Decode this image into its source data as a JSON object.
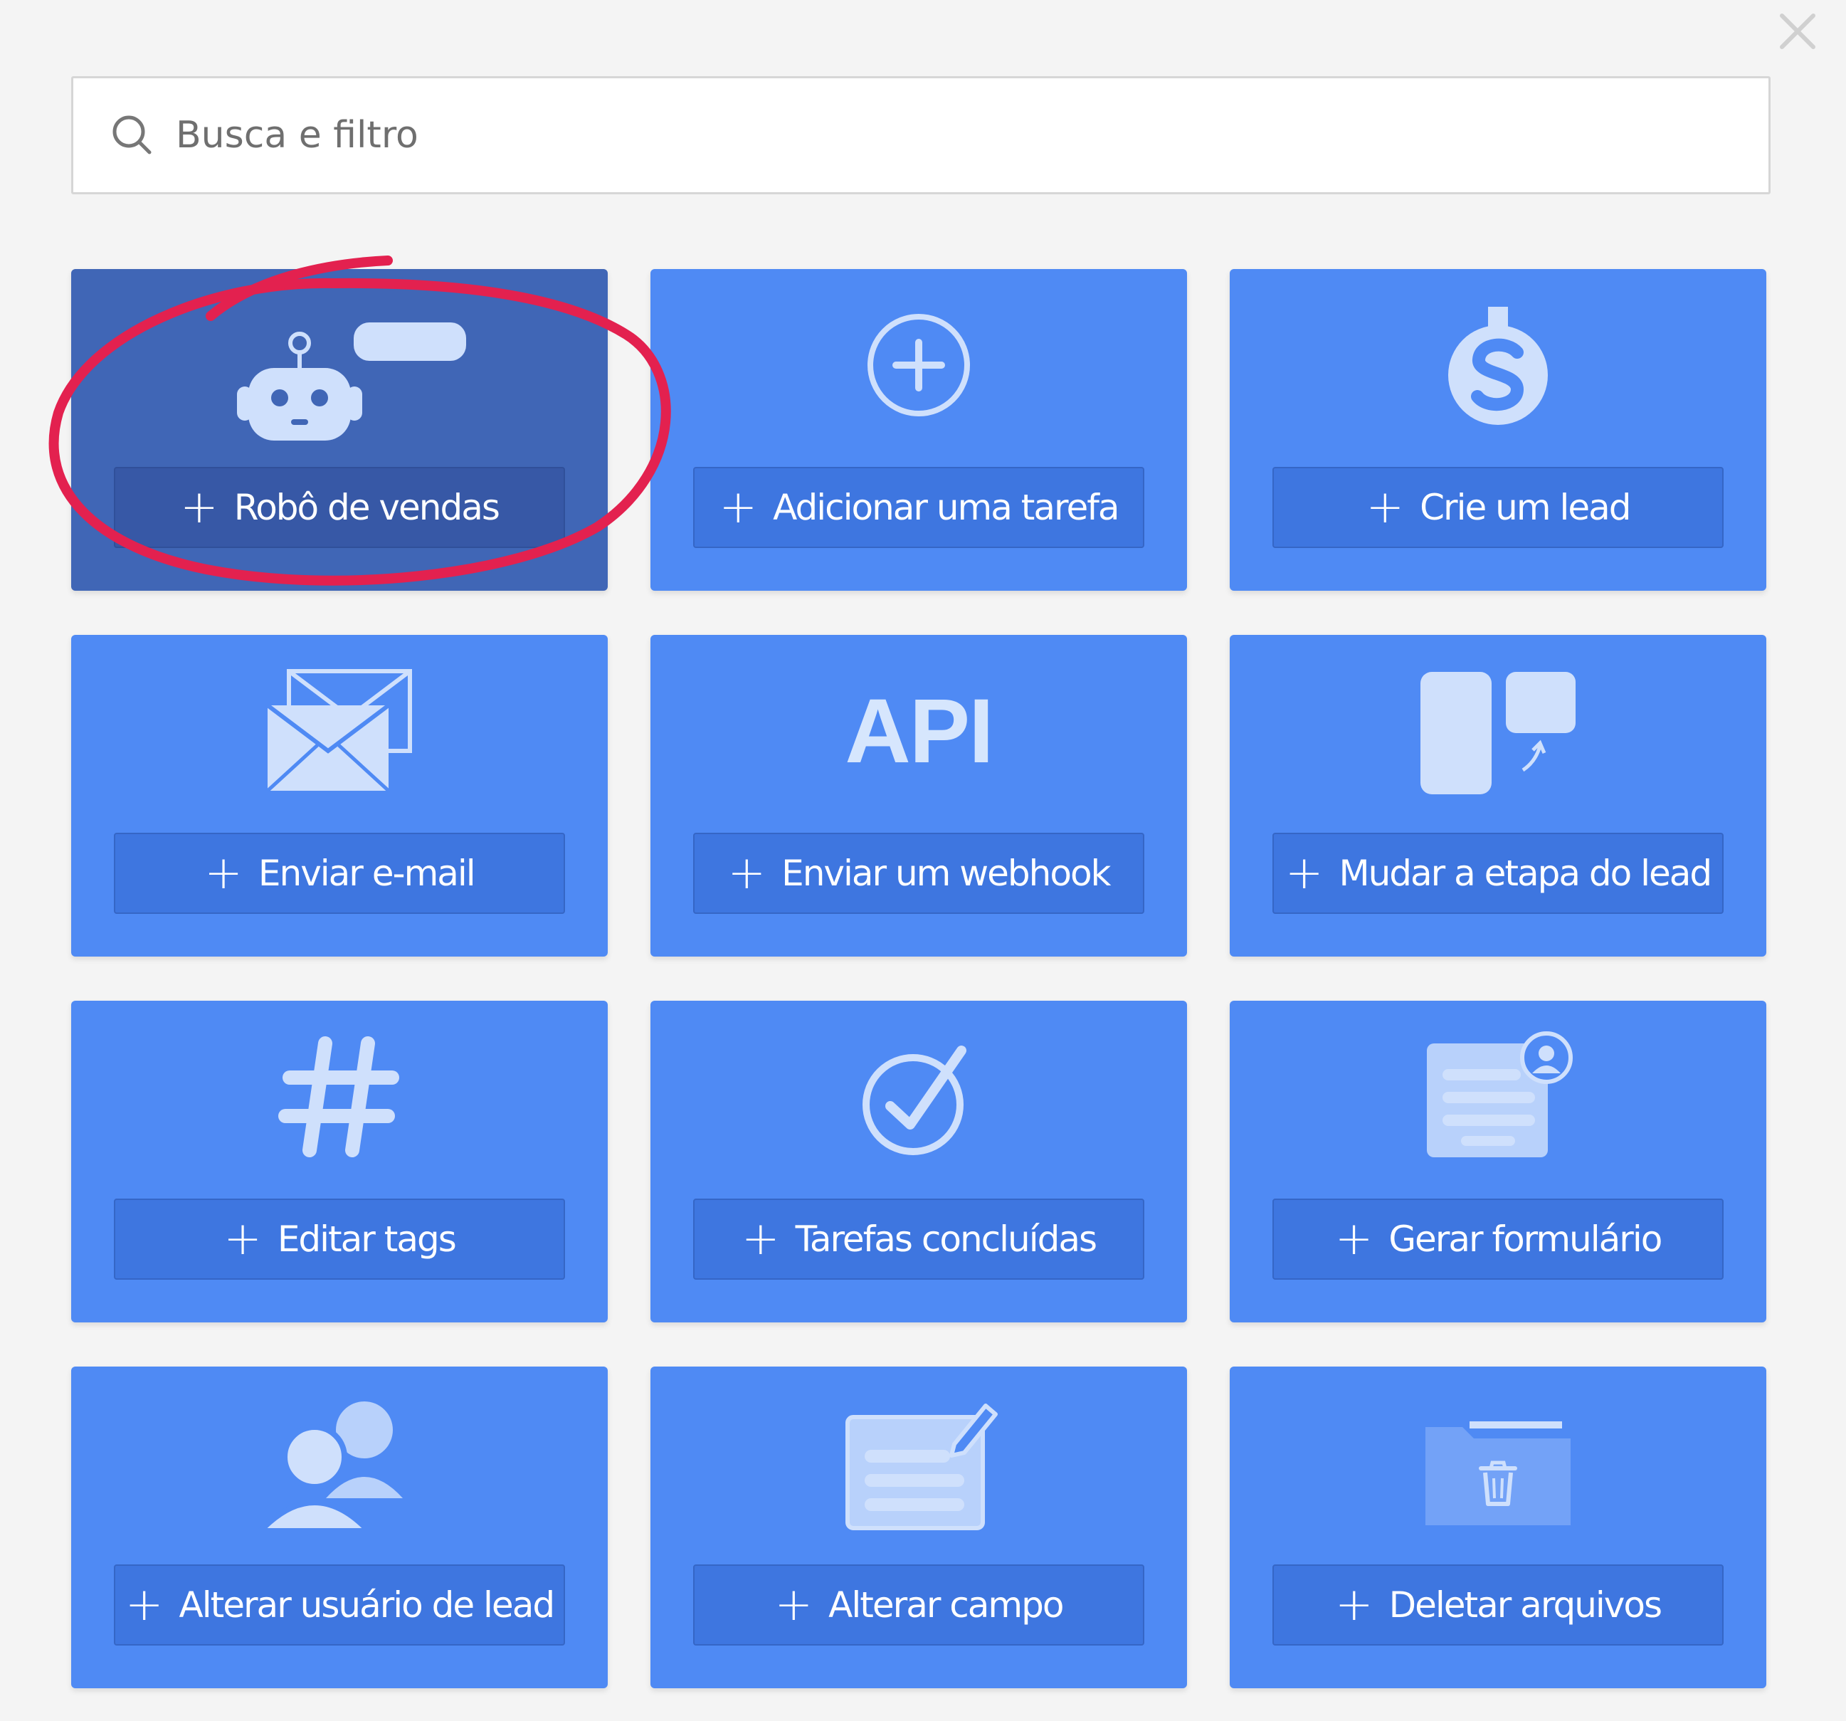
{
  "search": {
    "placeholder": "Busca e filtro",
    "icon": "search-icon"
  },
  "close_icon": "close-icon",
  "tiles": [
    {
      "label": "Robô de vendas",
      "icon": "robot-icon",
      "selected": true
    },
    {
      "label": "Adicionar uma tarefa",
      "icon": "plus-circle-icon"
    },
    {
      "label": "Crie um lead",
      "icon": "dollar-icon"
    },
    {
      "label": "Enviar e-mail",
      "icon": "envelope-icon"
    },
    {
      "label": "Enviar um webhook",
      "icon": "api-icon",
      "icon_text": "API"
    },
    {
      "label": "Mudar a etapa do lead",
      "icon": "stage-change-icon"
    },
    {
      "label": "Editar tags",
      "icon": "hashtag-icon"
    },
    {
      "label": "Tarefas concluídas",
      "icon": "check-circle-icon"
    },
    {
      "label": "Gerar formulário",
      "icon": "form-icon"
    },
    {
      "label": "Alterar usuário de lead",
      "icon": "users-icon"
    },
    {
      "label": "Alterar campo",
      "icon": "edit-field-icon"
    },
    {
      "label": "Deletar arquivos",
      "icon": "delete-folder-icon"
    }
  ],
  "plus_symbol": "+",
  "colors": {
    "tile": "#4f8af4",
    "tile_selected": "#4066b6",
    "annotation": "#e3214f",
    "background": "#f4f4f4"
  }
}
